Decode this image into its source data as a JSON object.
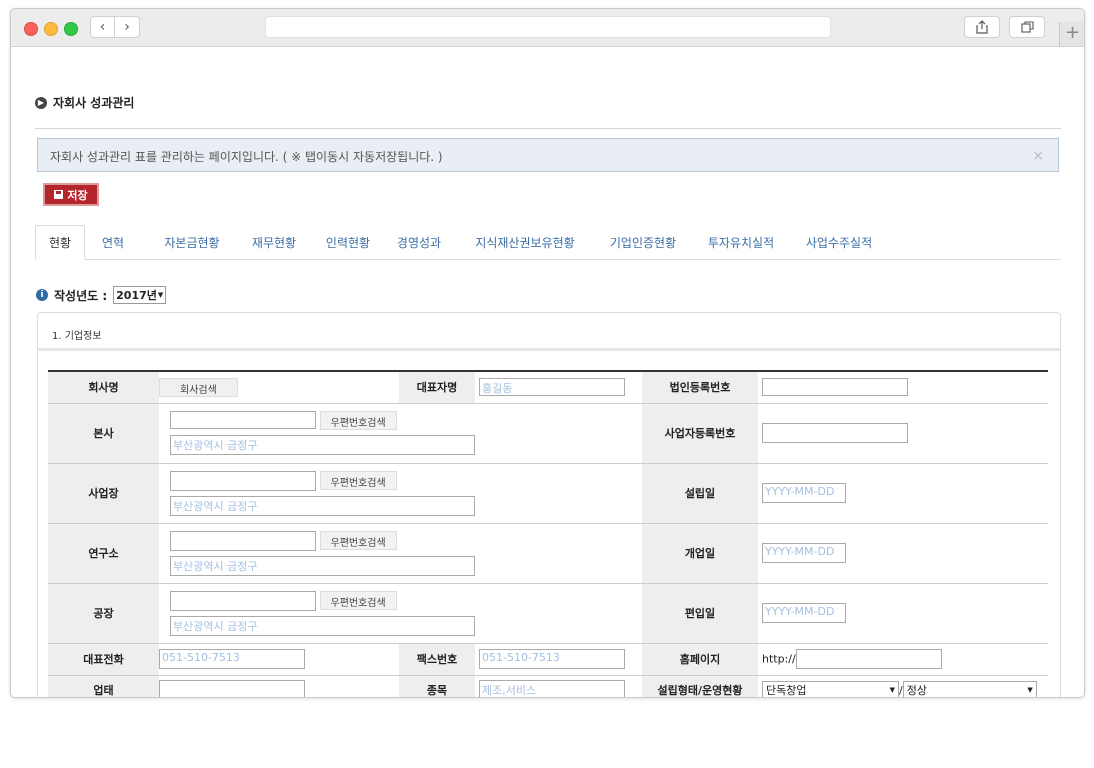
{
  "browser": {
    "back_icon": "‹",
    "forward_icon": "›",
    "plus_icon": "+"
  },
  "page": {
    "title": "자회사 성과관리",
    "info_text": "자회사 성과관리 표를 관리하는 페이지입니다. ( ※ 탭이동시 자동저장됩니다. )",
    "close_icon": "×",
    "save_label": "저장"
  },
  "tabs": [
    {
      "label": "현황",
      "active": true
    },
    {
      "label": "연혁"
    },
    {
      "label": "자본금현황"
    },
    {
      "label": "재무현황"
    },
    {
      "label": "인력현황"
    },
    {
      "label": "경영성과"
    },
    {
      "label": "지식재산권보유현황"
    },
    {
      "label": "기업인증현황"
    },
    {
      "label": "투자유치실적"
    },
    {
      "label": "사업수주실적"
    }
  ],
  "year": {
    "label": "작성년도 :",
    "value": "2017년",
    "info_icon": "i"
  },
  "section": {
    "title": "1. 기업정보"
  },
  "form": {
    "company_name_label": "회사명",
    "company_search_btn": "회사검색",
    "ceo_label": "대표자명",
    "ceo_placeholder": "홍길동",
    "corp_reg_label": "법인등록번호",
    "zip_search_btn": "우편번호검색",
    "address_placeholder": "부산광역시 금정구",
    "hq_label": "본사",
    "biz_reg_label": "사업자등록번호",
    "workplace_label": "사업장",
    "founded_label": "설립일",
    "date_placeholder": "YYYY-MM-DD",
    "lab_label": "연구소",
    "opened_label": "개업일",
    "factory_label": "공장",
    "joined_label": "편입일",
    "phone_label": "대표전화",
    "phone_placeholder": "051-510-7513",
    "fax_label": "팩스번호",
    "fax_placeholder": "051-510-7513",
    "homepage_label": "홈페이지",
    "homepage_prefix": "http://",
    "business_type_label": "업태",
    "item_label": "종목",
    "item_placeholder": "제조,서비스",
    "founding_status_label": "설립형태/운영현황",
    "founding_type_value": "단독창업",
    "separator": "/",
    "status_value": "정상",
    "dropdown_icon": "▼"
  }
}
